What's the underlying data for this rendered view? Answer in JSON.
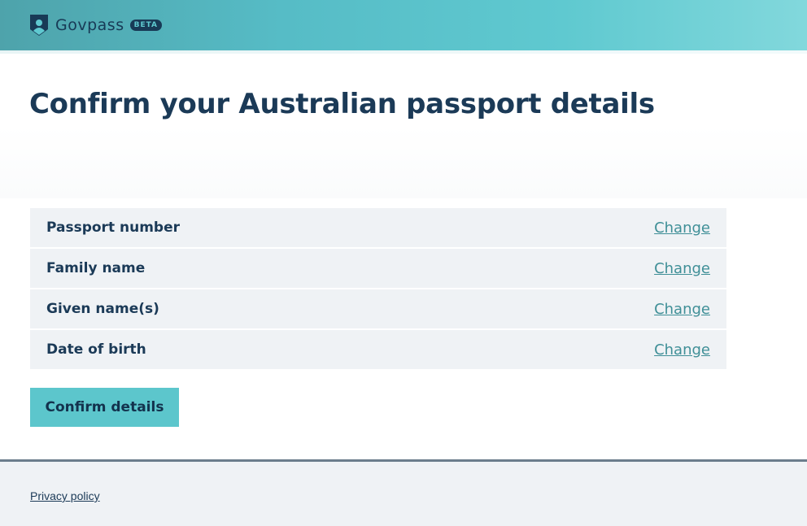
{
  "header": {
    "brand": "Govpass",
    "badge": "BETA",
    "logo_icon": "shield-person-icon"
  },
  "main": {
    "title": "Confirm your Australian passport details",
    "rows": [
      {
        "label": "Passport number",
        "action": "Change"
      },
      {
        "label": "Family name",
        "action": "Change"
      },
      {
        "label": "Given name(s)",
        "action": "Change"
      },
      {
        "label": "Date of birth",
        "action": "Change"
      }
    ],
    "confirm_label": "Confirm details"
  },
  "footer": {
    "privacy_link": "Privacy policy"
  },
  "colors": {
    "header_teal": "#5fc9d0",
    "text_navy": "#1b3a57",
    "link_teal": "#3f8f97",
    "button_teal": "#5cc6cc",
    "row_bg": "#eff2f5"
  }
}
